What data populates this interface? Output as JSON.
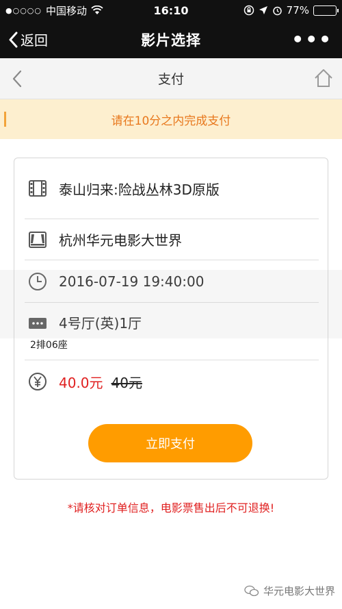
{
  "status_bar": {
    "carrier": "中国移动",
    "time": "16:10",
    "battery": "77%",
    "battery_fraction": 0.77
  },
  "wechat_nav": {
    "back_label": "返回",
    "title": "影片选择",
    "more_label": "•••"
  },
  "page": {
    "title": "支付"
  },
  "notice": {
    "text": "请在10分之内完成支付"
  },
  "order": {
    "movie": "泰山归来:险战丛林3D原版",
    "cinema": "杭州华元电影大世界",
    "showtime": "2016-07-19 19:40:00",
    "hall": "4号厅(英)1厅",
    "seat": "2排06座",
    "price_now": "40.0元",
    "price_old": "40元"
  },
  "actions": {
    "pay_button": "立即支付"
  },
  "warning": {
    "text": "*请核对订单信息，电影票售出后不可退换!"
  },
  "footer": {
    "account": "华元电影大世界"
  },
  "colors": {
    "accent": "#ff9c00",
    "notice_bg": "#fdefcf",
    "notice_text": "#e8781d",
    "price": "#e02020"
  }
}
